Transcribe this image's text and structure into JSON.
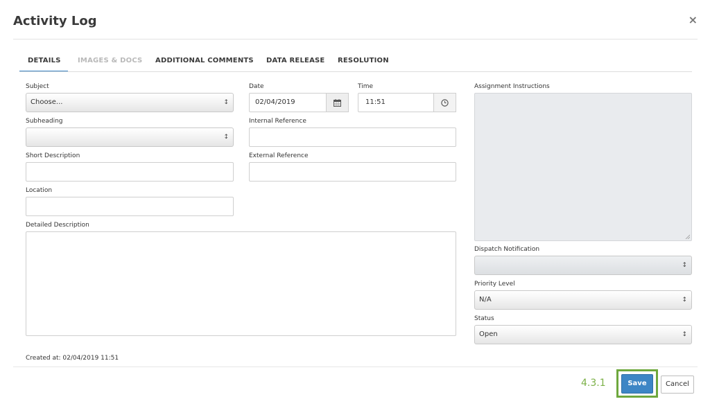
{
  "dialog": {
    "title": "Activity Log",
    "close_glyph": "×"
  },
  "tabs": [
    {
      "label": "DETAILS",
      "active": true
    },
    {
      "label": "IMAGES & DOCS",
      "disabled": true
    },
    {
      "label": "ADDITIONAL COMMENTS"
    },
    {
      "label": "DATA RELEASE"
    },
    {
      "label": "RESOLUTION"
    }
  ],
  "form": {
    "subject": {
      "label": "Subject",
      "value": "Choose..."
    },
    "subheading": {
      "label": "Subheading",
      "value": ""
    },
    "short_description": {
      "label": "Short Description",
      "value": ""
    },
    "location": {
      "label": "Location",
      "value": ""
    },
    "detailed_description": {
      "label": "Detailed Description",
      "value": ""
    },
    "date": {
      "label": "Date",
      "value": "02/04/2019",
      "icon": "calendar-icon"
    },
    "time": {
      "label": "Time",
      "value": "11:51",
      "icon": "clock-icon"
    },
    "internal_reference": {
      "label": "Internal Reference",
      "value": ""
    },
    "external_reference": {
      "label": "External Reference",
      "value": ""
    },
    "assignment_instructions": {
      "label": "Assignment Instructions",
      "value": ""
    },
    "dispatch_notification": {
      "label": "Dispatch Notification",
      "value": ""
    },
    "priority_level": {
      "label": "Priority Level",
      "value": "N/A"
    },
    "status": {
      "label": "Status",
      "value": "Open"
    }
  },
  "footer": {
    "created_at": "Created at: 02/04/2019 11:51",
    "version": "4.3.1",
    "save_label": "Save",
    "cancel_label": "Cancel"
  },
  "colors": {
    "accent": "#3d86c5",
    "highlight": "#6ea83d",
    "disabled_bg": "#e9ebee"
  }
}
